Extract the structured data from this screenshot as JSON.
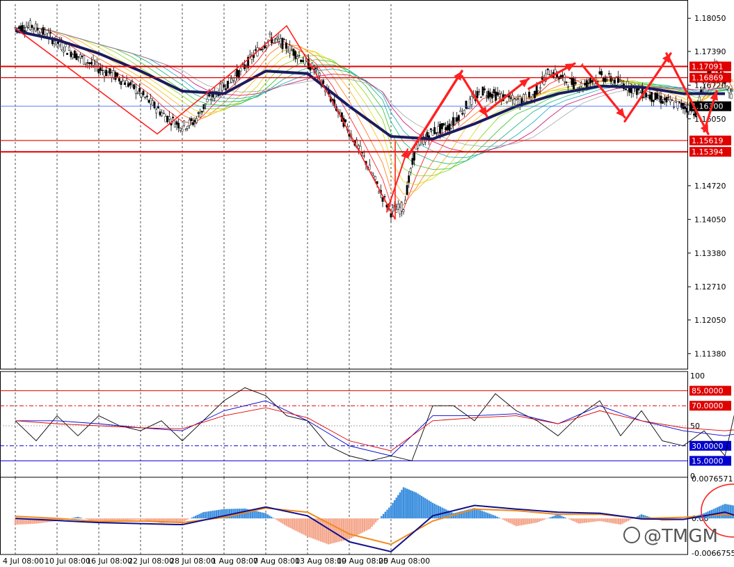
{
  "chart_data": [
    {
      "type": "candlestick",
      "name": "price",
      "y_ticks": [
        "1.18050",
        "1.17390",
        "1.16720",
        "1.16050",
        "1.14720",
        "1.14050",
        "1.13380",
        "1.12710",
        "1.12050",
        "1.11380"
      ],
      "ylim": [
        1.1108,
        1.1833
      ],
      "current_price": {
        "value": 1.163,
        "label": "1.16300"
      },
      "levels": [
        {
          "value": 1.17091,
          "label": "1.17091",
          "color": "#e00000"
        },
        {
          "value": 1.16869,
          "label": "1.16869",
          "color": "#e00000"
        },
        {
          "value": 1.15619,
          "label": "1.15619",
          "color": "#e00000"
        },
        {
          "value": 1.15394,
          "label": "1.15394",
          "color": "#e00000"
        }
      ],
      "x_labels": [
        "4 Jul 08:00",
        "10 Jul 08:00",
        "16 Jul 08:00",
        "22 Jul 08:00",
        "28 Jul 08:00",
        "1 Aug 08:00",
        "7 Aug 08:00",
        "13 Aug 08:00",
        "19 Aug 08:00",
        "25 Aug 08:00"
      ],
      "close_path": [
        [
          0,
          1.1785
        ],
        [
          0.4,
          1.179
        ],
        [
          0.8,
          1.177
        ],
        [
          1.2,
          1.1745
        ],
        [
          1.6,
          1.1725
        ],
        [
          2.0,
          1.1705
        ],
        [
          2.4,
          1.169
        ],
        [
          2.8,
          1.167
        ],
        [
          3.2,
          1.164
        ],
        [
          3.6,
          1.161
        ],
        [
          4.0,
          1.159
        ],
        [
          4.3,
          1.16
        ],
        [
          4.6,
          1.164
        ],
        [
          5.0,
          1.167
        ],
        [
          5.4,
          1.17
        ],
        [
          5.8,
          1.174
        ],
        [
          6.1,
          1.1765
        ],
        [
          6.4,
          1.1755
        ],
        [
          6.8,
          1.173
        ],
        [
          7.2,
          1.17
        ],
        [
          7.6,
          1.164
        ],
        [
          8.0,
          1.158
        ],
        [
          8.4,
          1.152
        ],
        [
          8.8,
          1.145
        ],
        [
          9.0,
          1.142
        ],
        [
          9.3,
          1.143
        ],
        [
          9.6,
          1.155
        ],
        [
          10.0,
          1.158
        ],
        [
          10.4,
          1.159
        ],
        [
          10.8,
          1.163
        ],
        [
          11.2,
          1.166
        ],
        [
          11.6,
          1.165
        ],
        [
          12.0,
          1.164
        ],
        [
          12.4,
          1.165
        ],
        [
          12.8,
          1.17
        ],
        [
          13.2,
          1.168
        ],
        [
          13.6,
          1.167
        ],
        [
          14.0,
          1.169
        ],
        [
          14.4,
          1.168
        ],
        [
          14.8,
          1.1665
        ],
        [
          15.2,
          1.165
        ],
        [
          15.6,
          1.164
        ],
        [
          16.0,
          1.163
        ],
        [
          16.3,
          1.162
        ],
        [
          16.6,
          1.17
        ],
        [
          16.8,
          1.171
        ],
        [
          17.0,
          1.168
        ],
        [
          17.2,
          1.1645
        ]
      ],
      "ma_guppy_slow": [
        [
          0,
          1.178
        ],
        [
          1,
          1.1762
        ],
        [
          2,
          1.1735
        ],
        [
          3,
          1.17
        ],
        [
          4,
          1.166
        ],
        [
          5,
          1.1655
        ],
        [
          6,
          1.17
        ],
        [
          7,
          1.1695
        ],
        [
          8,
          1.163
        ],
        [
          9,
          1.157
        ],
        [
          10,
          1.1565
        ],
        [
          11,
          1.1595
        ],
        [
          12,
          1.163
        ],
        [
          13,
          1.1655
        ],
        [
          14,
          1.167
        ],
        [
          15,
          1.1668
        ],
        [
          16,
          1.1655
        ],
        [
          17,
          1.1655
        ]
      ]
    },
    {
      "type": "line",
      "name": "oscillator",
      "y_ticks": [
        "100",
        "50",
        "0"
      ],
      "ylim": [
        0,
        100
      ],
      "levels": [
        {
          "value": 85,
          "label": "85.0000",
          "color": "#e00000"
        },
        {
          "value": 70,
          "label": "70.0000",
          "color": "#e00000"
        },
        {
          "value": 30,
          "label": "30.0000",
          "color": "#0000d0"
        },
        {
          "value": 15,
          "label": "15.0000",
          "color": "#0000d0"
        }
      ],
      "series": [
        {
          "color": "#000000",
          "values": [
            [
              0,
              55
            ],
            [
              0.5,
              35
            ],
            [
              1,
              60
            ],
            [
              1.5,
              40
            ],
            [
              2,
              60
            ],
            [
              2.5,
              50
            ],
            [
              3,
              45
            ],
            [
              3.5,
              55
            ],
            [
              4,
              35
            ],
            [
              4.5,
              55
            ],
            [
              5,
              75
            ],
            [
              5.5,
              88
            ],
            [
              6,
              80
            ],
            [
              6.5,
              60
            ],
            [
              7,
              55
            ],
            [
              7.5,
              30
            ],
            [
              8,
              20
            ],
            [
              8.5,
              15
            ],
            [
              9,
              20
            ],
            [
              9.5,
              15
            ],
            [
              10,
              70
            ],
            [
              10.5,
              70
            ],
            [
              11,
              55
            ],
            [
              11.5,
              82
            ],
            [
              12,
              65
            ],
            [
              12.5,
              55
            ],
            [
              13,
              40
            ],
            [
              13.5,
              60
            ],
            [
              14,
              75
            ],
            [
              14.5,
              40
            ],
            [
              15,
              65
            ],
            [
              15.5,
              35
            ],
            [
              16,
              30
            ],
            [
              16.5,
              45
            ],
            [
              17,
              20
            ],
            [
              17.3,
              75
            ],
            [
              17.7,
              45
            ]
          ]
        },
        {
          "color": "#0000d0",
          "values": [
            [
              0,
              55
            ],
            [
              1,
              55
            ],
            [
              2,
              52
            ],
            [
              3,
              48
            ],
            [
              4,
              45
            ],
            [
              5,
              65
            ],
            [
              6,
              75
            ],
            [
              7,
              55
            ],
            [
              8,
              30
            ],
            [
              9,
              20
            ],
            [
              10,
              60
            ],
            [
              11,
              60
            ],
            [
              12,
              62
            ],
            [
              13,
              52
            ],
            [
              14,
              70
            ],
            [
              15,
              55
            ],
            [
              16,
              45
            ],
            [
              17,
              40
            ],
            [
              17.7,
              45
            ]
          ]
        },
        {
          "color": "#e00000",
          "values": [
            [
              0,
              55
            ],
            [
              1,
              52
            ],
            [
              2,
              50
            ],
            [
              3,
              48
            ],
            [
              4,
              47
            ],
            [
              5,
              60
            ],
            [
              6,
              68
            ],
            [
              7,
              58
            ],
            [
              8,
              35
            ],
            [
              9,
              25
            ],
            [
              10,
              55
            ],
            [
              11,
              58
            ],
            [
              12,
              60
            ],
            [
              13,
              52
            ],
            [
              14,
              65
            ],
            [
              15,
              55
            ],
            [
              16,
              48
            ],
            [
              17,
              45
            ],
            [
              17.7,
              48
            ]
          ]
        }
      ]
    },
    {
      "type": "bar",
      "name": "macd",
      "y_ticks": [
        "0.0076571",
        "0.00",
        "-0.0066755"
      ],
      "ylim": [
        -0.0066755,
        0.0076571
      ],
      "histogram": [
        [
          0,
          -0.0012
        ],
        [
          0.5,
          -0.001
        ],
        [
          1,
          -0.0005
        ],
        [
          1.5,
          0.0003
        ],
        [
          2,
          -0.0008
        ],
        [
          2.5,
          -0.0005
        ],
        [
          3,
          -0.0002
        ],
        [
          3.5,
          -0.0009
        ],
        [
          4,
          -0.0007
        ],
        [
          4.5,
          0.0012
        ],
        [
          5,
          0.0018
        ],
        [
          5.5,
          0.0019
        ],
        [
          6,
          0.001
        ],
        [
          6.5,
          -0.0015
        ],
        [
          7,
          -0.0035
        ],
        [
          7.5,
          -0.005
        ],
        [
          8,
          -0.004
        ],
        [
          8.5,
          -0.002
        ],
        [
          9,
          0.0025
        ],
        [
          9.3,
          0.006
        ],
        [
          9.6,
          0.005
        ],
        [
          10,
          0.003
        ],
        [
          10.5,
          0.001
        ],
        [
          11,
          0.002
        ],
        [
          11.5,
          0.0005
        ],
        [
          12,
          -0.0015
        ],
        [
          12.5,
          -0.0008
        ],
        [
          13,
          0.0008
        ],
        [
          13.5,
          -0.001
        ],
        [
          14,
          -0.0005
        ],
        [
          14.5,
          -0.0012
        ],
        [
          15,
          0.0008
        ],
        [
          15.5,
          -0.0005
        ],
        [
          16,
          -0.0003
        ],
        [
          16.5,
          0.001
        ],
        [
          17,
          0.0028
        ],
        [
          17.4,
          0.0022
        ]
      ],
      "signal_orange": [
        [
          0,
          0.0004
        ],
        [
          1,
          0.0
        ],
        [
          2,
          -0.0006
        ],
        [
          3,
          -0.0005
        ],
        [
          4,
          -0.0008
        ],
        [
          5,
          0.0002
        ],
        [
          6,
          0.002
        ],
        [
          7,
          0.0012
        ],
        [
          8,
          -0.003
        ],
        [
          9,
          -0.005
        ],
        [
          10,
          -0.0005
        ],
        [
          11,
          0.0018
        ],
        [
          12,
          0.0015
        ],
        [
          13,
          0.0008
        ],
        [
          14,
          0.0008
        ],
        [
          15,
          0.0
        ],
        [
          16,
          0.0002
        ],
        [
          17,
          0.0008
        ],
        [
          17.5,
          0.0002
        ]
      ],
      "macd_blue": [
        [
          0,
          0.0
        ],
        [
          1,
          -0.0004
        ],
        [
          2,
          -0.0008
        ],
        [
          3,
          -0.001
        ],
        [
          4,
          -0.0012
        ],
        [
          5,
          0.0005
        ],
        [
          6,
          0.0022
        ],
        [
          7,
          0.0005
        ],
        [
          8,
          -0.0045
        ],
        [
          9,
          -0.0064
        ],
        [
          10,
          0.0005
        ],
        [
          11,
          0.0025
        ],
        [
          12,
          0.0018
        ],
        [
          13,
          0.0012
        ],
        [
          14,
          0.001
        ],
        [
          15,
          -0.0001
        ],
        [
          16,
          -0.0002
        ],
        [
          17,
          0.0012
        ],
        [
          17.5,
          -0.0001
        ]
      ]
    }
  ],
  "watermark": "@TMGM"
}
